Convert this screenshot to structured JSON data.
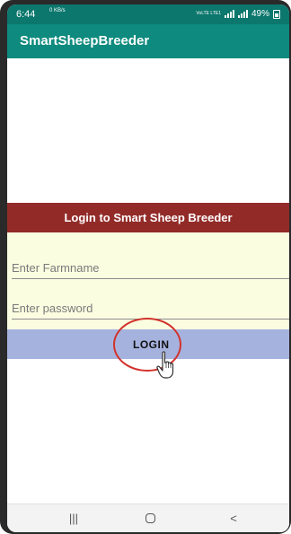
{
  "status_bar": {
    "time": "6:44",
    "network_speed": "0 KB/s",
    "volte_label": "VoLTE LTE1",
    "battery": "49%"
  },
  "app_bar": {
    "title": "SmartSheepBreeder"
  },
  "login": {
    "banner_title": "Login to Smart Sheep Breeder",
    "farmname_placeholder": "Enter Farmname",
    "farmname_value": "",
    "password_placeholder": "Enter password",
    "password_value": "",
    "button_label": "LOGIN"
  },
  "nav_bar": {
    "recents_glyph": "|||",
    "back_glyph": "<"
  },
  "colors": {
    "status_bar": "#0b776d",
    "app_bar": "#0e8a7e",
    "banner": "#922b28",
    "form_background": "#fbfde0",
    "login_button": "#a6b2de",
    "highlight": "#d2322b"
  },
  "icons": [
    "signal-icon",
    "battery-icon",
    "hand-cursor-icon",
    "recents-icon",
    "home-icon",
    "back-icon"
  ]
}
